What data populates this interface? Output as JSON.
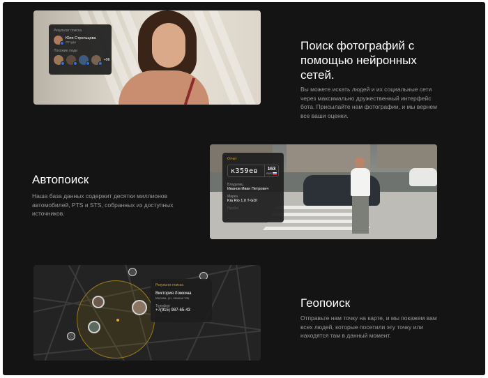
{
  "section_photo": {
    "heading": "Поиск фотографий с помощью нейронных сетей.",
    "description": "Вы можете искать людей и их социальные сети через максимально дружественный интерфейс бота. Присылайте нам фотографии, и мы вернем все ваши оценки.",
    "panel": {
      "result_label": "Результат поиска",
      "result_name": "Юля Стрельцова",
      "result_sub": "Оттуда",
      "similar_label": "Похожие люди",
      "more_count": "+96"
    }
  },
  "section_auto": {
    "heading": "Автопоиск",
    "description": "Наша база данных содержит десятки миллионов автомобилей, PTS и STS, собранных из доступных источников.",
    "panel": {
      "report_label": "Отчет",
      "plate_number": "к359ев",
      "plate_region": "163",
      "plate_country": "RUS",
      "owner_label": "Владелец",
      "owner_value": "Иванов Иван Петрович",
      "model_label": "Марка",
      "model_value": "Kia Rio 1.0 T-GDI",
      "extra_label": "Пробег"
    }
  },
  "section_geo": {
    "heading": "Геопоиск",
    "description": "Отправьте нам точку на карте, и мы покажем вам всех людей, которые посетили эту точку или находятся там в данный момент.",
    "panel": {
      "result_label": "Результат поиска",
      "name": "Виктория Ложкина",
      "address": "Москва, ул. Авиаза 12к",
      "phone_label": "Телефон",
      "phone_value": "+7(915) 987-65-43"
    }
  },
  "colors": {
    "background": "#141414",
    "accent_gold": "#c9a02c",
    "social_blue": "#2f6fe0"
  }
}
